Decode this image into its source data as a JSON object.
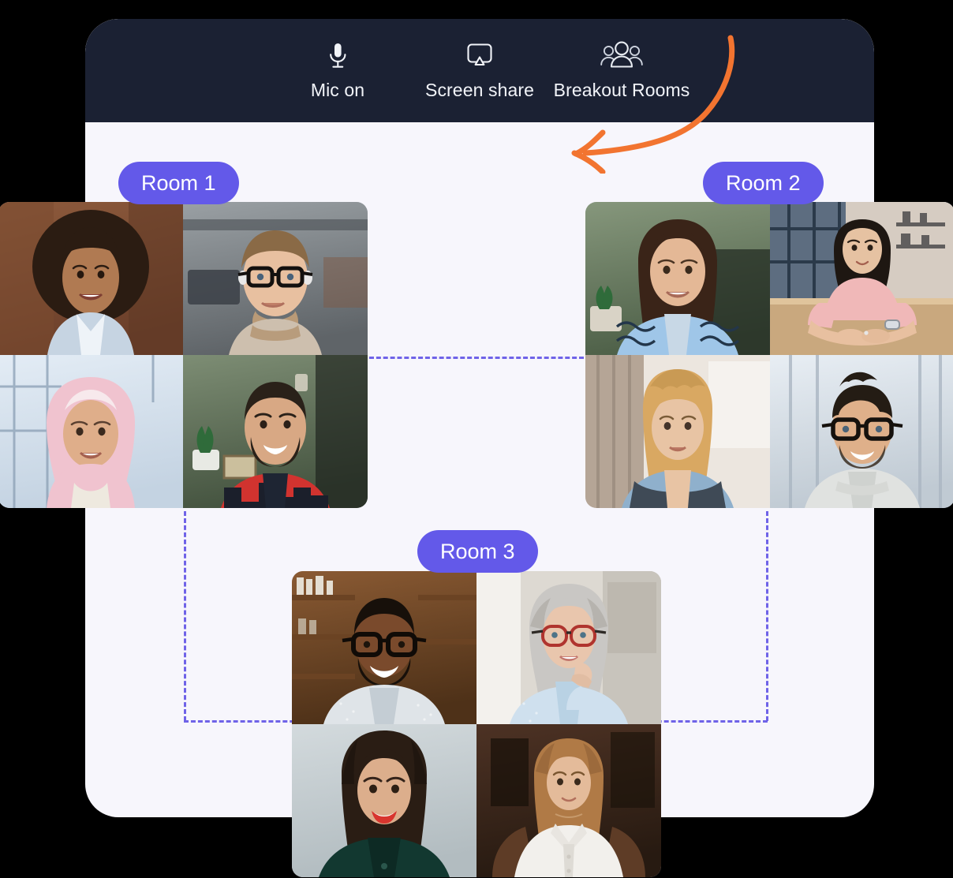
{
  "toolbar": {
    "background_color": "#1B2133",
    "buttons": [
      {
        "label": "Mic on",
        "icon": "microphone-icon"
      },
      {
        "label": "Screen share",
        "icon": "screen-share-icon"
      },
      {
        "label": "Breakout Rooms",
        "icon": "people-group-icon"
      }
    ]
  },
  "annotation": {
    "arrow_icon": "curved-arrow-icon",
    "arrow_color": "#F27430",
    "points_to": "Breakout Rooms"
  },
  "theme": {
    "card_background": "#F7F6FC",
    "accent_purple": "#6359E9",
    "connector_purple": "#6F63E8",
    "accent_orange": "#F27430",
    "header_dark": "#1B2133"
  },
  "rooms": [
    {
      "label": "Room 1",
      "participants": [
        {
          "name": "participant-1",
          "skin": "#b07a52",
          "hair": "#2b1c12",
          "shirt": "#c6d4e2",
          "bg_top": "#8d5a3c",
          "bg_bottom": "#6b3f2a",
          "style": "curly-afro"
        },
        {
          "name": "participant-2",
          "skin": "#e8c0a0",
          "hair": "#8a6a46",
          "shirt": "#cdbfae",
          "bg_top": "#9aa0a4",
          "bg_bottom": "#5f6468",
          "style": "glasses-short"
        },
        {
          "name": "participant-3",
          "skin": "#dfae8a",
          "hair": "#f0c3cf",
          "shirt": "#e8e4dc",
          "bg_top": "#dfe8f2",
          "bg_bottom": "#c4d3e2",
          "style": "hijab"
        },
        {
          "name": "participant-4",
          "skin": "#d8a884",
          "hair": "#2a2119",
          "shirt": "#d1332f",
          "bg_top": "#74836d",
          "bg_bottom": "#41503c",
          "style": "beard-plaid"
        }
      ]
    },
    {
      "label": "Room 2",
      "participants": [
        {
          "name": "participant-5",
          "skin": "#e4b896",
          "hair": "#3a2418",
          "shirt": "#9fc6e8",
          "bg_top": "#7d8f74",
          "bg_bottom": "#56684f",
          "style": "long-dark-hair"
        },
        {
          "name": "participant-6",
          "skin": "#e6c2a2",
          "hair": "#1e1712",
          "shirt": "#f0b8b8",
          "bg_top": "#9fb0c2",
          "bg_bottom": "#cbb79c",
          "style": "desk-seated"
        },
        {
          "name": "participant-7",
          "skin": "#e8c4a4",
          "hair": "#d9a862",
          "shirt": "#8fb0cc",
          "bg_top": "#d8cec4",
          "bg_bottom": "#b8ada2",
          "style": "curly-blonde"
        },
        {
          "name": "participant-8",
          "skin": "#dfb08a",
          "hair": "#241c14",
          "shirt": "#e0e2e0",
          "bg_top": "#dfe6ec",
          "bg_bottom": "#c0cad3",
          "style": "quiff-glasses"
        }
      ]
    },
    {
      "label": "Room 3",
      "participants": [
        {
          "name": "participant-9",
          "skin": "#7a4a2c",
          "hair": "#17100a",
          "shirt": "#dfe4e8",
          "bg_top": "#8a5a33",
          "bg_bottom": "#5a3a20",
          "style": "glasses-beard-dark"
        },
        {
          "name": "participant-10",
          "skin": "#e9c6ad",
          "hair": "#c9c7c4",
          "shirt": "#cfe0ee",
          "bg_top": "#e4e2de",
          "bg_bottom": "#c9c6c0",
          "style": "grey-hair-glasses"
        },
        {
          "name": "participant-11",
          "skin": "#dcae8c",
          "hair": "#2a1d14",
          "shirt": "#123830",
          "bg_top": "#ccd5d8",
          "bg_bottom": "#b6c0c4",
          "style": "red-lips"
        },
        {
          "name": "participant-12",
          "skin": "#e4bb9a",
          "hair": "#b07a46",
          "shirt": "#f2f0ec",
          "bg_top": "#4a3022",
          "bg_bottom": "#2a1b12",
          "style": "white-blouse"
        }
      ]
    }
  ]
}
